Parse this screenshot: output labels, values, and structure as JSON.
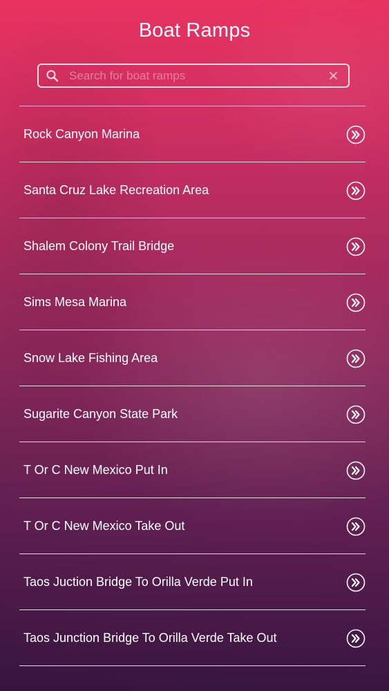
{
  "header": {
    "title": "Boat Ramps"
  },
  "search": {
    "placeholder": "Search for boat ramps",
    "value": "",
    "search_icon": "search-icon",
    "clear_icon": "clear-icon"
  },
  "ramps": [
    {
      "label": "Rock Canyon Marina",
      "icon": "double-chevron-right-icon"
    },
    {
      "label": "Santa Cruz Lake Recreation Area",
      "icon": "double-chevron-right-icon"
    },
    {
      "label": "Shalem Colony Trail Bridge",
      "icon": "double-chevron-right-icon"
    },
    {
      "label": "Sims Mesa Marina",
      "icon": "double-chevron-right-icon"
    },
    {
      "label": "Snow Lake Fishing Area",
      "icon": "double-chevron-right-icon"
    },
    {
      "label": "Sugarite Canyon State Park",
      "icon": "double-chevron-right-icon"
    },
    {
      "label": "T Or C New Mexico Put In",
      "icon": "double-chevron-right-icon"
    },
    {
      "label": "T Or C New Mexico Take Out",
      "icon": "double-chevron-right-icon"
    },
    {
      "label": "Taos Juction Bridge To Orilla Verde Put In",
      "icon": "double-chevron-right-icon"
    },
    {
      "label": "Taos Junction Bridge To Orilla Verde Take Out",
      "icon": "double-chevron-right-icon"
    }
  ],
  "colors": {
    "gradient_top": "#e8325f",
    "gradient_bottom": "#3e1748",
    "text": "#ffffff"
  }
}
